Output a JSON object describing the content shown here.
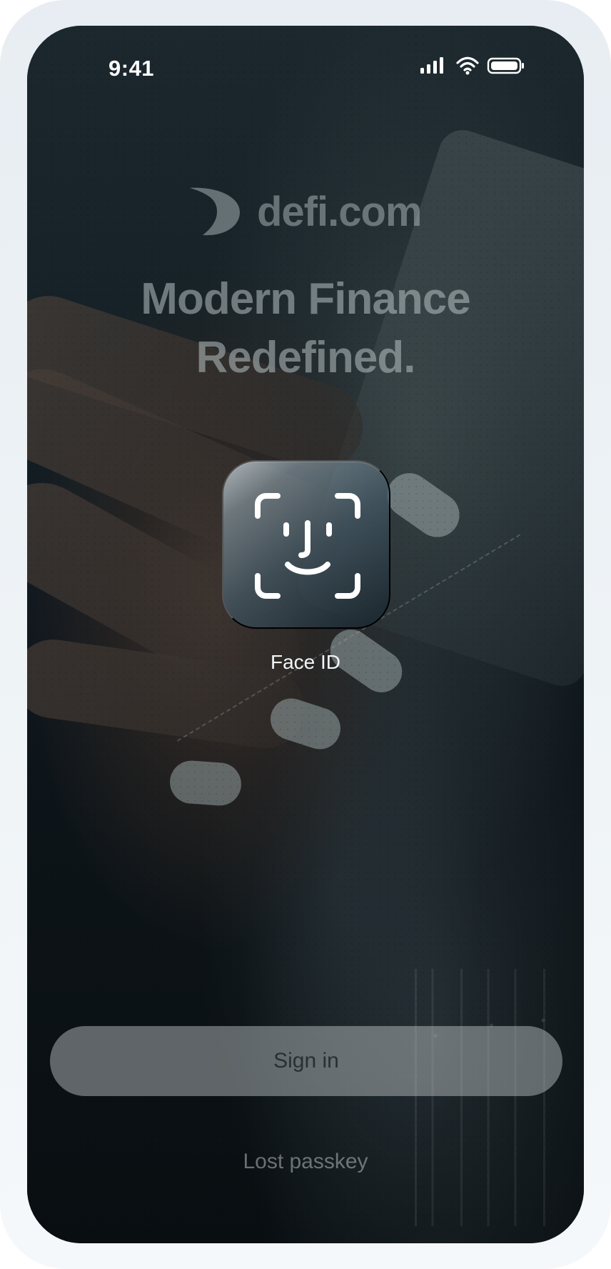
{
  "status_bar": {
    "time": "9:41",
    "icons": [
      "signal-icon",
      "wifi-icon",
      "battery-icon"
    ]
  },
  "branding": {
    "logo_icon": "defi-logo-icon",
    "name": "defi.com"
  },
  "hero": {
    "title_line_1": "Modern Finance",
    "title_line_2": "Redefined."
  },
  "face_id": {
    "icon": "face-id-icon",
    "label": "Face ID"
  },
  "actions": {
    "sign_in_label": "Sign in",
    "lost_passkey_label": "Lost passkey"
  },
  "colors": {
    "screen_background": "#10171b",
    "device_frame": "#eef3f6",
    "text_primary": "#ffffff",
    "button_background": "#bcc2c5",
    "button_text": "#263035"
  }
}
